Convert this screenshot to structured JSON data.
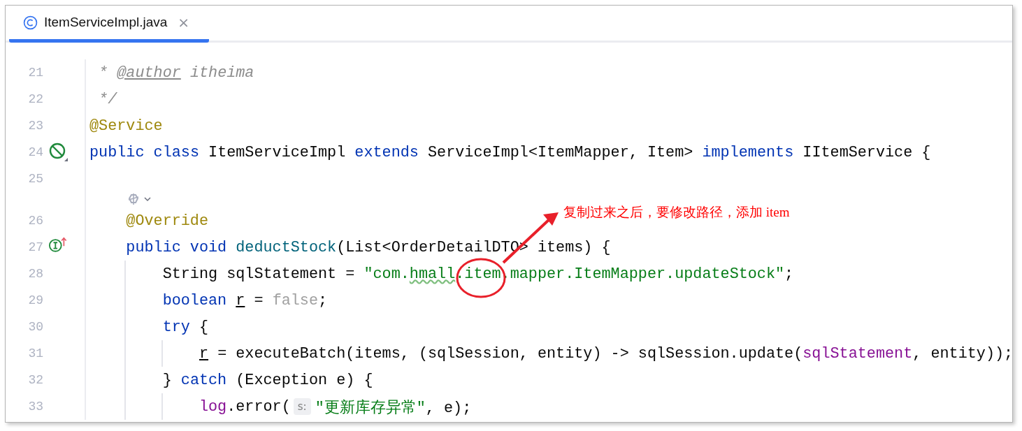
{
  "tab": {
    "title": "ItemServiceImpl.java",
    "close": "×",
    "selected": true
  },
  "lines": [
    {
      "kind": "code",
      "number": "21",
      "segments": [
        {
          "kind": "code",
          "tokens": [
            {
              "t": " * ",
              "kind": "cmt"
            },
            {
              "t": "@author",
              "kind": "cmt-tag"
            },
            {
              "t": " itheima",
              "kind": "cmt"
            }
          ]
        }
      ]
    },
    {
      "kind": "code",
      "number": "22",
      "segments": [
        {
          "kind": "code",
          "tokens": [
            {
              "t": " */",
              "kind": "cmt"
            }
          ]
        }
      ]
    },
    {
      "kind": "code",
      "number": "23",
      "segments": [
        {
          "kind": "code",
          "tokens": [
            {
              "t": "@Service",
              "kind": "ann"
            }
          ]
        }
      ]
    },
    {
      "kind": "code",
      "number": "24",
      "gutter": {
        "kind": "no-entry"
      },
      "segments": [
        {
          "kind": "code",
          "tokens": [
            {
              "t": "public class ",
              "kind": "kw"
            },
            {
              "t": "ItemServiceImpl ",
              "kind": "plain"
            },
            {
              "t": "extends ",
              "kind": "kw"
            },
            {
              "t": "ServiceImpl<ItemMapper, Item> ",
              "kind": "plain"
            },
            {
              "t": "implements ",
              "kind": "kw"
            },
            {
              "t": "IItemService {",
              "kind": "plain"
            }
          ]
        }
      ],
      "children": [
        {
          "kind": "code",
          "number": "25"
        },
        {
          "kind": "codevision"
        },
        {
          "kind": "code",
          "number": "26",
          "segments": [
            {
              "kind": "code",
              "tokens": [
                {
                  "t": "@Override",
                  "kind": "ann"
                }
              ]
            }
          ]
        },
        {
          "kind": "code",
          "number": "27",
          "gutter": {
            "kind": "implements"
          },
          "segments": [
            {
              "kind": "code",
              "tokens": [
                {
                  "t": "public void ",
                  "kind": "kw"
                },
                {
                  "t": "deductStock",
                  "kind": "method"
                },
                {
                  "t": "(List<OrderDetailDTO> items) {",
                  "kind": "plain"
                }
              ]
            }
          ],
          "children": [
            {
              "kind": "code",
              "number": "28",
              "segments": [
                {
                  "kind": "code",
                  "tokens": [
                    {
                      "t": "String sqlStatement = ",
                      "kind": "plain"
                    },
                    {
                      "t": "\"com.",
                      "kind": "str"
                    },
                    {
                      "t": "hmall",
                      "kind": "str-typo"
                    },
                    {
                      "t": ".item.mapper.ItemMapper.updateStock\"",
                      "kind": "str"
                    },
                    {
                      "t": ";",
                      "kind": "plain"
                    }
                  ]
                }
              ]
            },
            {
              "kind": "code",
              "number": "29",
              "segments": [
                {
                  "kind": "code",
                  "tokens": [
                    {
                      "t": "boolean ",
                      "kind": "kw"
                    },
                    {
                      "t": "r",
                      "kind": "reassigned"
                    },
                    {
                      "t": " = ",
                      "kind": "plain"
                    },
                    {
                      "t": "false",
                      "kind": "muted"
                    },
                    {
                      "t": ";",
                      "kind": "plain"
                    }
                  ]
                }
              ]
            },
            {
              "kind": "code",
              "number": "30",
              "segments": [
                {
                  "kind": "code",
                  "tokens": [
                    {
                      "t": "try",
                      "kind": "kw"
                    },
                    {
                      "t": " {",
                      "kind": "plain"
                    }
                  ]
                }
              ],
              "children": [
                {
                  "kind": "code",
                  "number": "31",
                  "segments": [
                    {
                      "kind": "code",
                      "tokens": [
                        {
                          "t": "r",
                          "kind": "reassigned"
                        },
                        {
                          "t": " = executeBatch(items, (sqlSession, entity) -> sqlSession.update(",
                          "kind": "plain"
                        },
                        {
                          "t": "sqlStatement",
                          "kind": "field"
                        },
                        {
                          "t": ", entity));",
                          "kind": "plain"
                        }
                      ]
                    }
                  ]
                }
              ]
            },
            {
              "kind": "code",
              "number": "32",
              "segments": [
                {
                  "kind": "code",
                  "tokens": [
                    {
                      "t": "} ",
                      "kind": "plain"
                    },
                    {
                      "t": "catch",
                      "kind": "kw"
                    },
                    {
                      "t": " (Exception e) {",
                      "kind": "plain"
                    }
                  ]
                }
              ],
              "children": [
                {
                  "kind": "code",
                  "number": "33",
                  "segments": [
                    {
                      "kind": "code",
                      "tokens": [
                        {
                          "t": "log",
                          "kind": "field"
                        },
                        {
                          "t": ".error(",
                          "kind": "plain"
                        }
                      ]
                    },
                    {
                      "kind": "hint",
                      "text": "s:"
                    },
                    {
                      "kind": "code",
                      "tokens": [
                        {
                          "t": "\"更新库存异常\"",
                          "kind": "str"
                        },
                        {
                          "t": ", e);",
                          "kind": "plain"
                        }
                      ]
                    }
                  ]
                }
              ]
            }
          ]
        }
      ]
    }
  ],
  "annotation": {
    "text": "复制过来之后，要修改路径，添加 item"
  }
}
